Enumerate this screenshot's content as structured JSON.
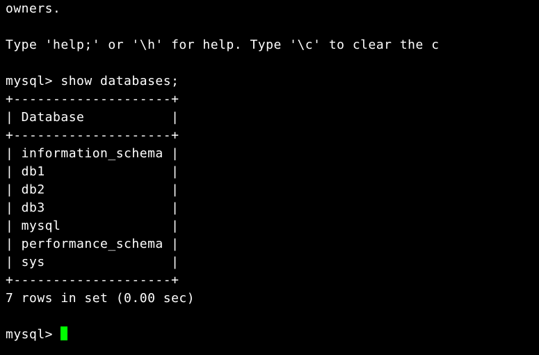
{
  "lines": {
    "owners": "owners.",
    "blank1": "",
    "help": "Type 'help;' or '\\h' for help. Type '\\c' to clear the c",
    "blank2": "",
    "prompt_cmd": "mysql> show databases;",
    "border_top": "+--------------------+",
    "header": "| Database           |",
    "border_mid": "+--------------------+",
    "row1": "| information_schema |",
    "row2": "| db1                |",
    "row3": "| db2                |",
    "row4": "| db3                |",
    "row5": "| mysql              |",
    "row6": "| performance_schema |",
    "row7": "| sys                |",
    "border_bot": "+--------------------+",
    "summary": "7 rows in set (0.00 sec)",
    "blank3": "",
    "prompt2": "mysql> "
  },
  "databases": [
    "information_schema",
    "db1",
    "db2",
    "db3",
    "mysql",
    "performance_schema",
    "sys"
  ],
  "row_count": 7,
  "query_time_sec": 0.0,
  "command": "show databases;",
  "prompt": "mysql>"
}
